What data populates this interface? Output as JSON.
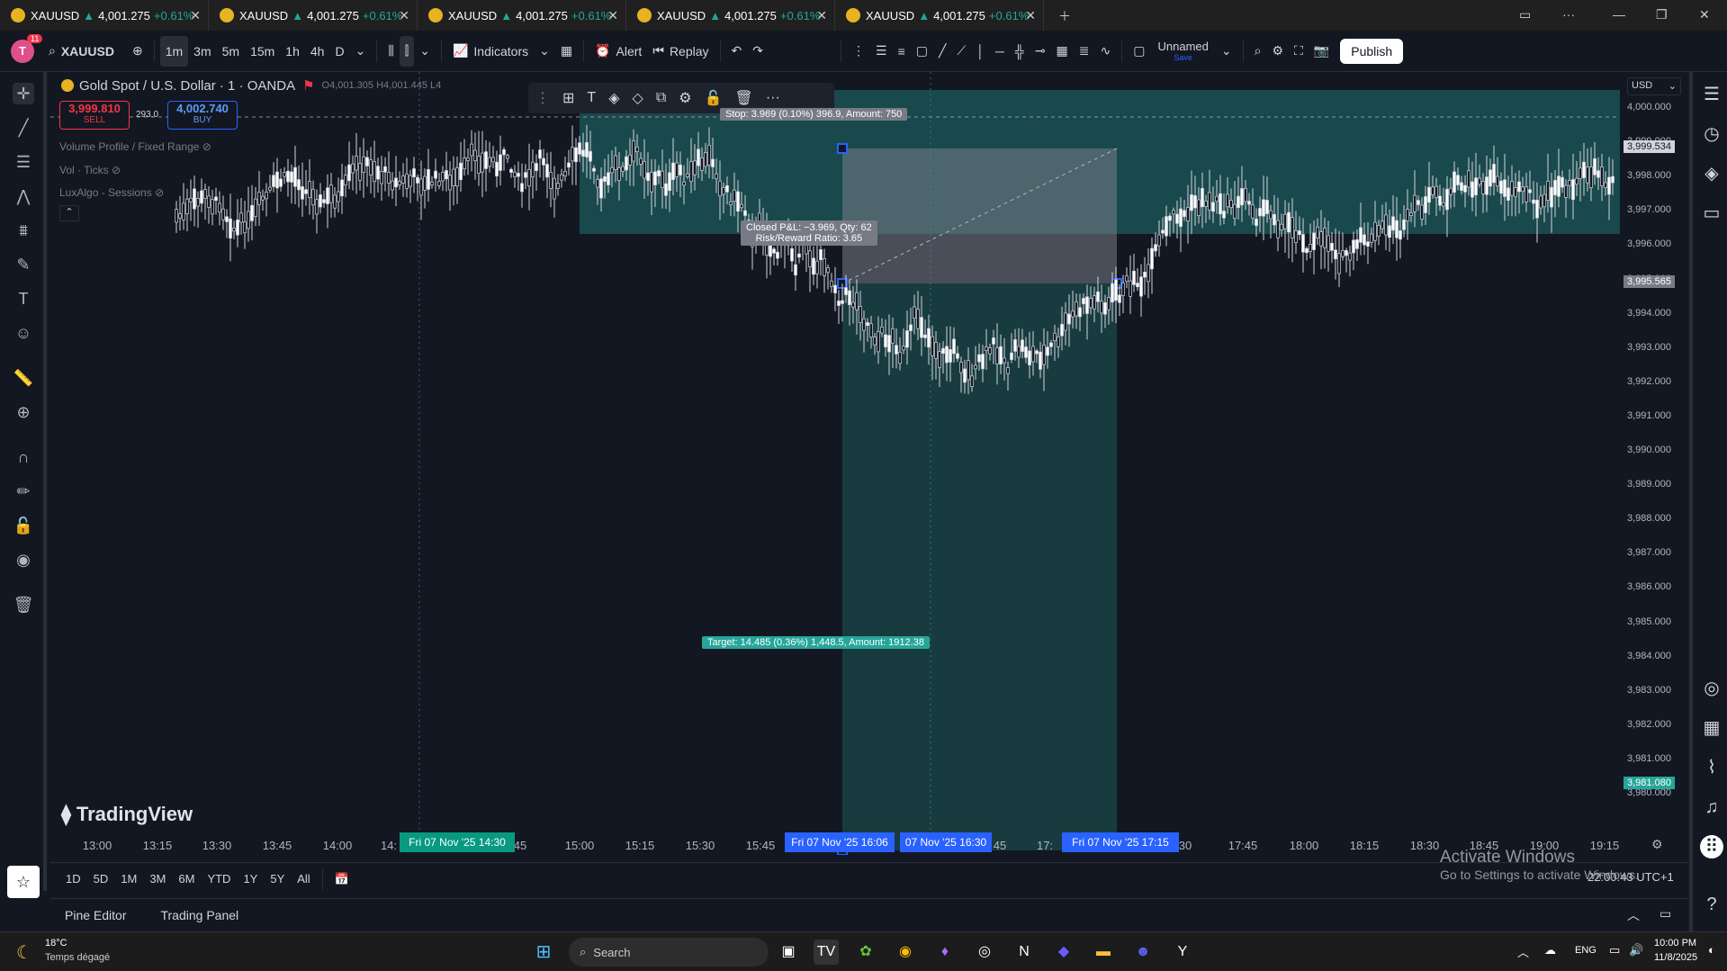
{
  "tabs": [
    {
      "symbol": "XAUUSD",
      "price": "4,001.275",
      "change": "+0.61%"
    },
    {
      "symbol": "XAUUSD",
      "price": "4,001.275",
      "change": "+0.61%"
    },
    {
      "symbol": "XAUUSD",
      "price": "4,001.275",
      "change": "+0.61%"
    },
    {
      "symbol": "XAUUSD",
      "price": "4,001.275",
      "change": "+0.61%"
    },
    {
      "symbol": "XAUUSD",
      "price": "4,001.275",
      "change": "+0.61%"
    }
  ],
  "toolbar": {
    "avatar_letter": "T",
    "notif_count": "11",
    "symbol": "XAUUSD",
    "intervals": [
      "1m",
      "3m",
      "5m",
      "15m",
      "1h",
      "4h",
      "D"
    ],
    "active_interval": "1m",
    "indicators": "Indicators",
    "alert": "Alert",
    "replay": "Replay",
    "layout_name": "Unnamed",
    "layout_sub": "Save",
    "publish": "Publish"
  },
  "legend": {
    "title": "Gold Spot / U.S. Dollar · 1 · OANDA",
    "ohlc": "O4,001.305 H4,001.445 L4",
    "sell_price": "3,999.810",
    "sell_label": "SELL",
    "spread": "293.0",
    "buy_price": "4,002.740",
    "buy_label": "BUY",
    "indicators": [
      "Volume Profile / Fixed Range",
      "Vol · Ticks",
      "LuxAlgo - Sessions"
    ]
  },
  "position": {
    "stop_label": "Stop: 3.969 (0.10%) 396.9, Amount: 750",
    "pnl_line1": "Closed P&L: −3.969, Qty: 62",
    "pnl_line2": "Risk/Reward Ratio: 3.65",
    "target_label": "Target: 14.485 (0.36%) 1,448.5, Amount: 1912.38"
  },
  "price_axis": {
    "currency": "USD",
    "ticks": [
      "4,000.000",
      "3,999.000",
      "3,998.000",
      "3,997.000",
      "3,996.000",
      "3,995.000",
      "3,994.000",
      "3,993.000",
      "3,992.000",
      "3,991.000",
      "3,990.000",
      "3,989.000",
      "3,988.000",
      "3,987.000",
      "3,986.000",
      "3,985.000",
      "3,984.000",
      "3,983.000",
      "3,982.000",
      "3,981.000",
      "3,980.000"
    ],
    "badge_current": "3,999.534",
    "badge_entry": "3,995.565",
    "badge_target": "3,981.080"
  },
  "time_axis": {
    "ticks": [
      "13:00",
      "13:15",
      "13:30",
      "13:45",
      "14:00",
      "14:",
      "45",
      "15:00",
      "15:15",
      "15:30",
      "15:45",
      "45",
      "17:",
      "30",
      "17:45",
      "18:00",
      "18:15",
      "18:30",
      "18:45",
      "19:00",
      "19:15"
    ],
    "markers": [
      "Fri 07 Nov '25  14:30",
      "Fri 07 Nov '25  16:06",
      "07 Nov '25  16:30",
      "Fri 07 Nov '25  17:15"
    ]
  },
  "watermark": "TradingView",
  "ranges": [
    "1D",
    "5D",
    "1M",
    "3M",
    "6M",
    "YTD",
    "1Y",
    "5Y",
    "All"
  ],
  "clock": "22:00:43 UTC+1",
  "activate": {
    "line1": "Activate Windows",
    "line2": "Go to Settings to activate Windows."
  },
  "panel": {
    "pine": "Pine Editor",
    "trading": "Trading Panel"
  },
  "taskbar": {
    "temp": "18°C",
    "weather": "Temps dégagé",
    "search": "Search",
    "lang": "ENG",
    "time": "10:00 PM",
    "date": "11/8/2025"
  },
  "colors": {
    "bg": "#131722",
    "profit": "#26a69a",
    "loss": "#787b86",
    "accent": "#2962ff"
  }
}
